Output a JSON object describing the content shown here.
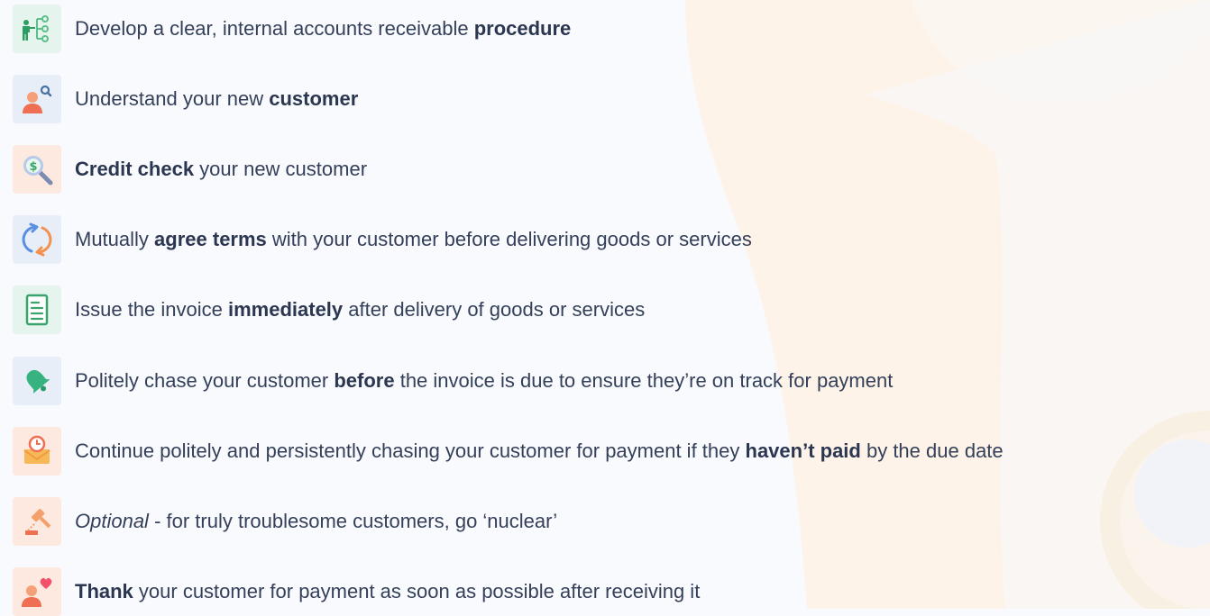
{
  "steps": [
    {
      "icon": "flowchart-person-icon",
      "tile_color": "#e5f4ec",
      "parts": [
        {
          "text": "Develop a clear, internal accounts receivable ",
          "style": "normal"
        },
        {
          "text": "procedure",
          "style": "bold"
        }
      ]
    },
    {
      "icon": "customer-search-icon",
      "tile_color": "#e7eef8",
      "parts": [
        {
          "text": "Understand your new ",
          "style": "normal"
        },
        {
          "text": "customer",
          "style": "bold"
        }
      ]
    },
    {
      "icon": "magnifier-dollar-icon",
      "tile_color": "#fde9df",
      "parts": [
        {
          "text": "Credit check",
          "style": "bold"
        },
        {
          "text": " your new customer",
          "style": "normal"
        }
      ]
    },
    {
      "icon": "refresh-arrows-icon",
      "tile_color": "#e7eef8",
      "parts": [
        {
          "text": "Mutually ",
          "style": "normal"
        },
        {
          "text": "agree terms",
          "style": "bold"
        },
        {
          "text": " with your customer before delivering goods or services",
          "style": "normal"
        }
      ]
    },
    {
      "icon": "invoice-document-icon",
      "tile_color": "#e5f4ec",
      "parts": [
        {
          "text": "Issue the invoice ",
          "style": "normal"
        },
        {
          "text": "immediately",
          "style": "bold"
        },
        {
          "text": " after delivery of goods or services",
          "style": "normal"
        }
      ]
    },
    {
      "icon": "bell-icon",
      "tile_color": "#e7eef8",
      "parts": [
        {
          "text": "Politely chase your customer ",
          "style": "normal"
        },
        {
          "text": "before",
          "style": "bold"
        },
        {
          "text": " the invoice is due to ensure they’re on track for payment",
          "style": "normal"
        }
      ]
    },
    {
      "icon": "envelope-clock-icon",
      "tile_color": "#fde9df",
      "parts": [
        {
          "text": "Continue politely and persistently chasing your customer for payment if they ",
          "style": "normal"
        },
        {
          "text": "haven’t paid",
          "style": "bold"
        },
        {
          "text": " by the due date",
          "style": "normal"
        }
      ]
    },
    {
      "icon": "gavel-icon",
      "tile_color": "#fde9df",
      "parts": [
        {
          "text": "Optional",
          "style": "italic"
        },
        {
          "text": " - for truly troublesome customers, go ‘nuclear’",
          "style": "normal"
        }
      ]
    },
    {
      "icon": "customer-heart-icon",
      "tile_color": "#fde9df",
      "parts": [
        {
          "text": "Thank",
          "style": "bold"
        },
        {
          "text": " your customer for payment as soon as possible after receiving it",
          "style": "normal"
        }
      ]
    }
  ]
}
